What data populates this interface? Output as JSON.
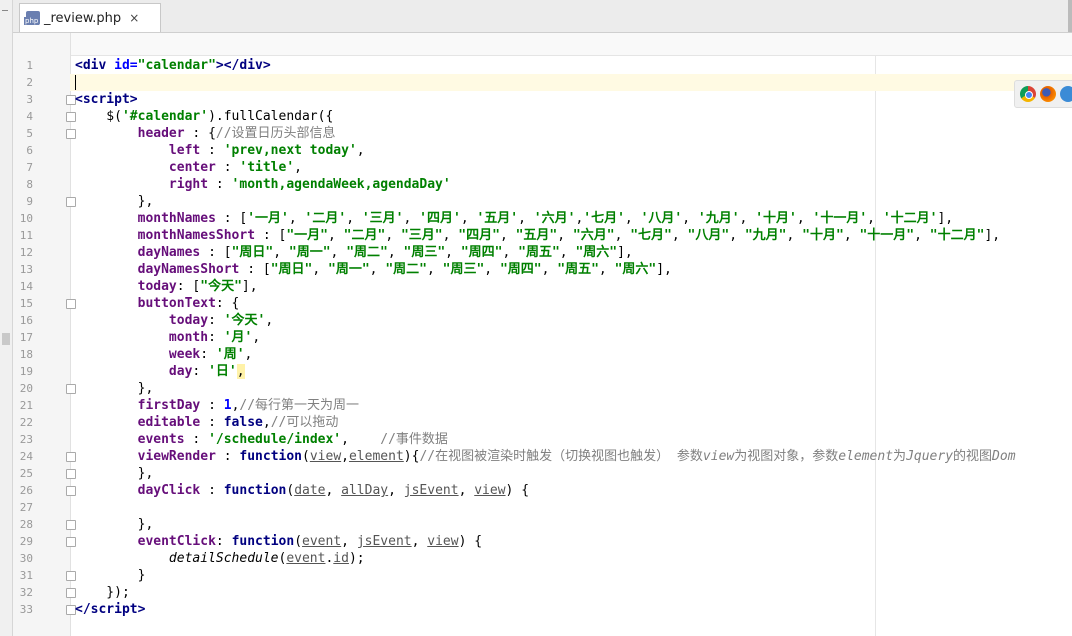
{
  "tab": {
    "filename": "_review.php",
    "close": "×"
  },
  "browsers": [
    "chrome-icon",
    "firefox-icon",
    "ie-icon"
  ],
  "lines": [
    {
      "n": "1",
      "fold": false,
      "html": "<span class='t'>&lt;div</span> <span class='a'>id=</span><span class='s'>\"calendar\"</span><span class='t'>&gt;&lt;/div&gt;</span>"
    },
    {
      "n": "2",
      "fold": false,
      "html": "<span class='caret'></span>"
    },
    {
      "n": "3",
      "fold": true,
      "html": "<span class='t'>&lt;script&gt;</span>"
    },
    {
      "n": "4",
      "fold": true,
      "html": "    $(<span class='s'>'#calendar'</span>).fullCalendar({"
    },
    {
      "n": "5",
      "fold": true,
      "html": "        <span class='p'>header</span> : {<span class='cc'>//设置日历头部信息</span>"
    },
    {
      "n": "6",
      "fold": false,
      "html": "            <span class='p'>left</span> : <span class='s'>'prev,next today'</span>,"
    },
    {
      "n": "7",
      "fold": false,
      "html": "            <span class='p'>center</span> : <span class='s'>'title'</span>,"
    },
    {
      "n": "8",
      "fold": false,
      "html": "            <span class='p'>right</span> : <span class='s'>'month,agendaWeek,agendaDay'</span>"
    },
    {
      "n": "9",
      "fold": true,
      "html": "        },"
    },
    {
      "n": "10",
      "fold": false,
      "html": "        <span class='p'>monthNames</span> : [<span class='s'>'一月'</span>, <span class='s'>'二月'</span>, <span class='s'>'三月'</span>, <span class='s'>'四月'</span>, <span class='s'>'五月'</span>, <span class='s'>'六月'</span>,<span class='s'>'七月'</span>, <span class='s'>'八月'</span>, <span class='s'>'九月'</span>, <span class='s'>'十月'</span>, <span class='s'>'十一月'</span>, <span class='s'>'十二月'</span>],"
    },
    {
      "n": "11",
      "fold": false,
      "html": "        <span class='p'>monthNamesShort</span> : [<span class='s'>\"一月\"</span>, <span class='s'>\"二月\"</span>, <span class='s'>\"三月\"</span>, <span class='s'>\"四月\"</span>, <span class='s'>\"五月\"</span>, <span class='s'>\"六月\"</span>, <span class='s'>\"七月\"</span>, <span class='s'>\"八月\"</span>, <span class='s'>\"九月\"</span>, <span class='s'>\"十月\"</span>, <span class='s'>\"十一月\"</span>, <span class='s'>\"十二月\"</span>],"
    },
    {
      "n": "12",
      "fold": false,
      "html": "        <span class='p'>dayNames</span> : [<span class='s'>\"周日\"</span>, <span class='s'>\"周一\"</span>, <span class='s'>\"周二\"</span>, <span class='s'>\"周三\"</span>, <span class='s'>\"周四\"</span>, <span class='s'>\"周五\"</span>, <span class='s'>\"周六\"</span>],"
    },
    {
      "n": "13",
      "fold": false,
      "html": "        <span class='p'>dayNamesShort</span> : [<span class='s'>\"周日\"</span>, <span class='s'>\"周一\"</span>, <span class='s'>\"周二\"</span>, <span class='s'>\"周三\"</span>, <span class='s'>\"周四\"</span>, <span class='s'>\"周五\"</span>, <span class='s'>\"周六\"</span>],"
    },
    {
      "n": "14",
      "fold": false,
      "html": "        <span class='p'>today</span>: [<span class='s'>\"今天\"</span>],"
    },
    {
      "n": "15",
      "fold": true,
      "html": "        <span class='p'>buttonText</span>: {"
    },
    {
      "n": "16",
      "fold": false,
      "html": "            <span class='p'>today</span>: <span class='s'>'今天'</span>,"
    },
    {
      "n": "17",
      "fold": false,
      "html": "            <span class='p'>month</span>: <span class='s'>'月'</span>,"
    },
    {
      "n": "18",
      "fold": false,
      "html": "            <span class='p'>week</span>: <span class='s'>'周'</span>,"
    },
    {
      "n": "19",
      "fold": false,
      "html": "            <span class='p'>day</span>: <span class='s'>'日'</span><span class='hl'>,</span>"
    },
    {
      "n": "20",
      "fold": true,
      "html": "        },"
    },
    {
      "n": "21",
      "fold": false,
      "html": "        <span class='p'>firstDay</span> : <span class='a'>1</span>,<span class='cc'>//每行第一天为周一</span>"
    },
    {
      "n": "22",
      "fold": false,
      "html": "        <span class='p'>editable</span> : <span class='k'>false</span>,<span class='cc'>//可以拖动</span>"
    },
    {
      "n": "23",
      "fold": false,
      "html": "        <span class='p'>events</span> : <span class='s'>'/schedule/index'</span>,    <span class='cc'>//事件数据</span>"
    },
    {
      "n": "24",
      "fold": true,
      "html": "        <span class='p'>viewRender</span> : <span class='k'>function</span>(<span class='u'>view</span>,<span class='u'>element</span>){<span class='cc'>//在视图被渲染时触发（切换视图也触发） 参数<i>view</i>为视图对象，参数<i>element</i>为<i>Jquery</i>的视图<i>Dom</i></span>"
    },
    {
      "n": "25",
      "fold": true,
      "html": "        },"
    },
    {
      "n": "26",
      "fold": true,
      "html": "        <span class='p'>dayClick</span> : <span class='k'>function</span>(<span class='u'>date</span>, <span class='u'>allDay</span>, <span class='u'>jsEvent</span>, <span class='u'>view</span>) {"
    },
    {
      "n": "27",
      "fold": false,
      "html": ""
    },
    {
      "n": "28",
      "fold": true,
      "html": "        },"
    },
    {
      "n": "29",
      "fold": true,
      "html": "        <span class='p'>eventClick</span>: <span class='k'>function</span>(<span class='u'>event</span>, <span class='u'>jsEvent</span>, <span class='u'>view</span>) {"
    },
    {
      "n": "30",
      "fold": false,
      "html": "            <span class='f'>detailSchedule</span>(<span class='u'>event</span>.<span class='u'>id</span>);"
    },
    {
      "n": "31",
      "fold": true,
      "html": "        }"
    },
    {
      "n": "32",
      "fold": true,
      "html": "    });"
    },
    {
      "n": "33",
      "fold": true,
      "html": "<span class='t'>&lt;/script&gt;</span>"
    }
  ]
}
